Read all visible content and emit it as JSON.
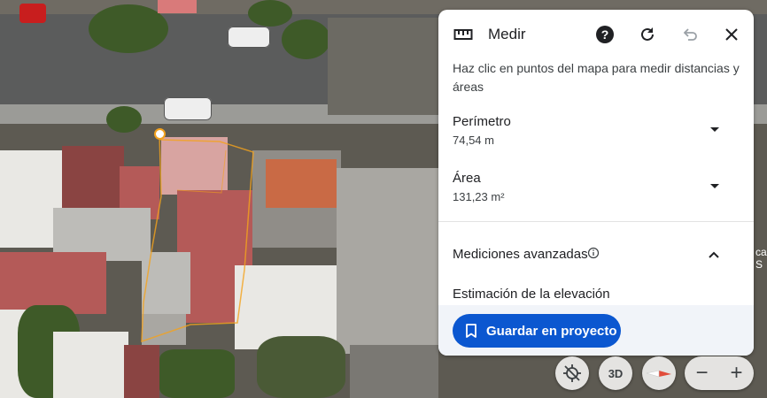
{
  "panel": {
    "title": "Medir",
    "instructions": "Haz clic en puntos del mapa para medir distancias y áreas",
    "perimeter": {
      "label": "Perímetro",
      "value": "74,54 m"
    },
    "area": {
      "label": "Área",
      "value": "131,23 m²"
    },
    "advanced": {
      "label": "Mediciones avanzadas"
    },
    "elevation_label": "Estimación de la elevación",
    "save_button": "Guardar en proyecto",
    "icons": {
      "header": "ruler-icon",
      "help": "help-icon",
      "refresh": "refresh-icon",
      "undo": "undo-icon",
      "close": "close-icon",
      "dropdown": "arrow-drop-down-icon",
      "info": "info-icon",
      "collapse": "chevron-up-icon",
      "save": "bookmark-icon"
    },
    "colors": {
      "accent": "#0b57d0",
      "measure_line": "#f4a21d",
      "footer_bg": "#f1f4f9"
    }
  },
  "map_controls": {
    "tilt_label": "3D",
    "zoom_out": "−",
    "zoom_in": "+"
  },
  "map": {
    "edge_label": "ca\nS"
  }
}
